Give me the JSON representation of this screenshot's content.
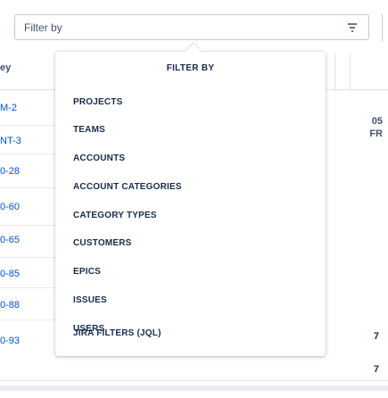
{
  "filter_bar": {
    "placeholder": "Filter by"
  },
  "popover": {
    "title": "FILTER BY",
    "items": [
      "PROJECTS",
      "TEAMS",
      "ACCOUNTS",
      "ACCOUNT CATEGORIES",
      "CATEGORY TYPES",
      "CUSTOMERS",
      "EPICS",
      "ISSUES",
      "USERS",
      "JIRA FILTERS (JQL)"
    ]
  },
  "background_table": {
    "key_header": "ey",
    "keys": [
      "M-2",
      "NT-3",
      "0-28",
      "0-60",
      "0-65",
      "0-85",
      "0-88",
      "0-93"
    ],
    "right_header_line1": "05",
    "right_header_line2": "FR",
    "right_values": [
      "7",
      "7"
    ]
  },
  "colors": {
    "link": "#0052cc",
    "text": "#172b4d",
    "border": "#c1c7d0"
  }
}
